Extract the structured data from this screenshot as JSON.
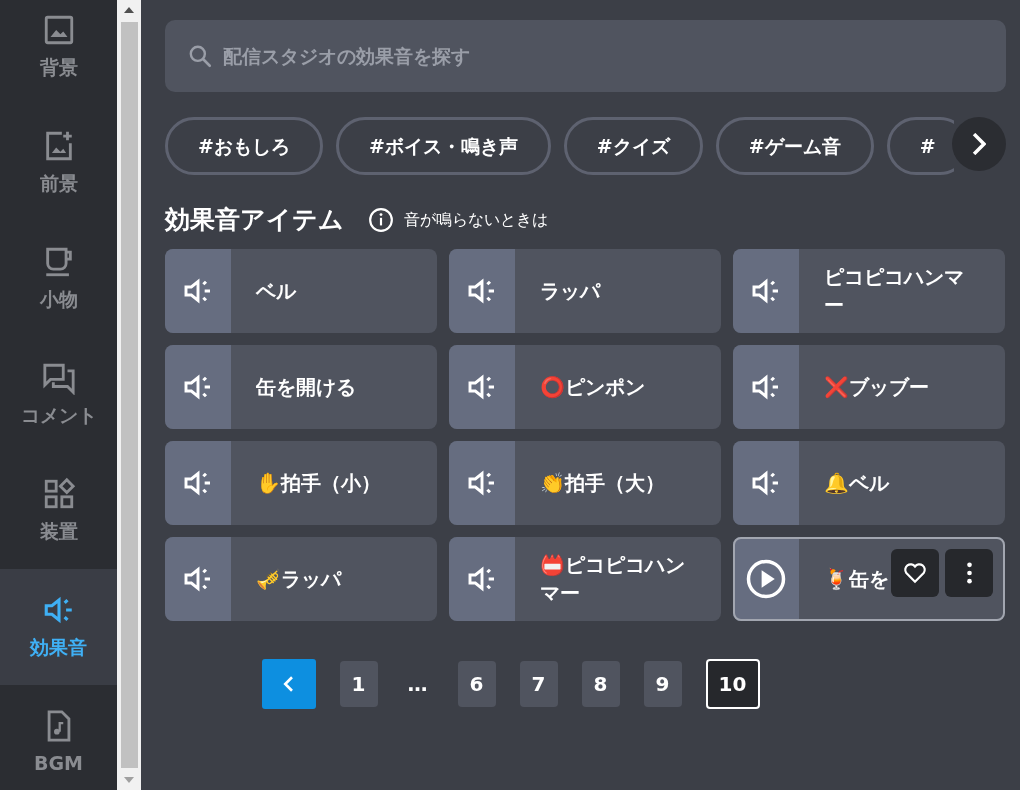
{
  "sidebar": {
    "items": [
      {
        "label": "背景",
        "selected": false
      },
      {
        "label": "前景",
        "selected": false
      },
      {
        "label": "小物",
        "selected": false
      },
      {
        "label": "コメント",
        "selected": false
      },
      {
        "label": "装置",
        "selected": false
      },
      {
        "label": "効果音",
        "selected": true
      },
      {
        "label": "BGM",
        "selected": false
      }
    ]
  },
  "search": {
    "placeholder": "配信スタジオの効果音を探す"
  },
  "tags": [
    {
      "label": "#おもしろ"
    },
    {
      "label": "#ボイス・鳴き声"
    },
    {
      "label": "#クイズ"
    },
    {
      "label": "#ゲーム音"
    },
    {
      "label": "#"
    }
  ],
  "section": {
    "title": "効果音アイテム",
    "help": "音が鳴らないときは"
  },
  "items": [
    {
      "label": "ベル",
      "hovered": false
    },
    {
      "label": "ラッパ",
      "hovered": false
    },
    {
      "label": "ピコピコハンマー",
      "hovered": false
    },
    {
      "label": "缶を開ける",
      "hovered": false
    },
    {
      "label": "⭕ピンポン",
      "hovered": false
    },
    {
      "label": "❌ブッブー",
      "hovered": false
    },
    {
      "label": "✋拍手（小）",
      "hovered": false
    },
    {
      "label": "👏拍手（大）",
      "hovered": false
    },
    {
      "label": "🔔ベル",
      "hovered": false
    },
    {
      "label": "🎺ラッパ",
      "hovered": false
    },
    {
      "label": "📛ピコピコハンマー",
      "hovered": false
    },
    {
      "label": "🍹缶を",
      "hovered": true
    }
  ],
  "pagination": {
    "pages": [
      {
        "label": "1",
        "kind": "page",
        "selected": false
      },
      {
        "label": "…",
        "kind": "ellipsis"
      },
      {
        "label": "6",
        "kind": "page",
        "selected": false
      },
      {
        "label": "7",
        "kind": "page",
        "selected": false
      },
      {
        "label": "8",
        "kind": "page",
        "selected": false
      },
      {
        "label": "9",
        "kind": "page",
        "selected": false
      },
      {
        "label": "10",
        "kind": "page",
        "selected": true
      }
    ]
  }
}
